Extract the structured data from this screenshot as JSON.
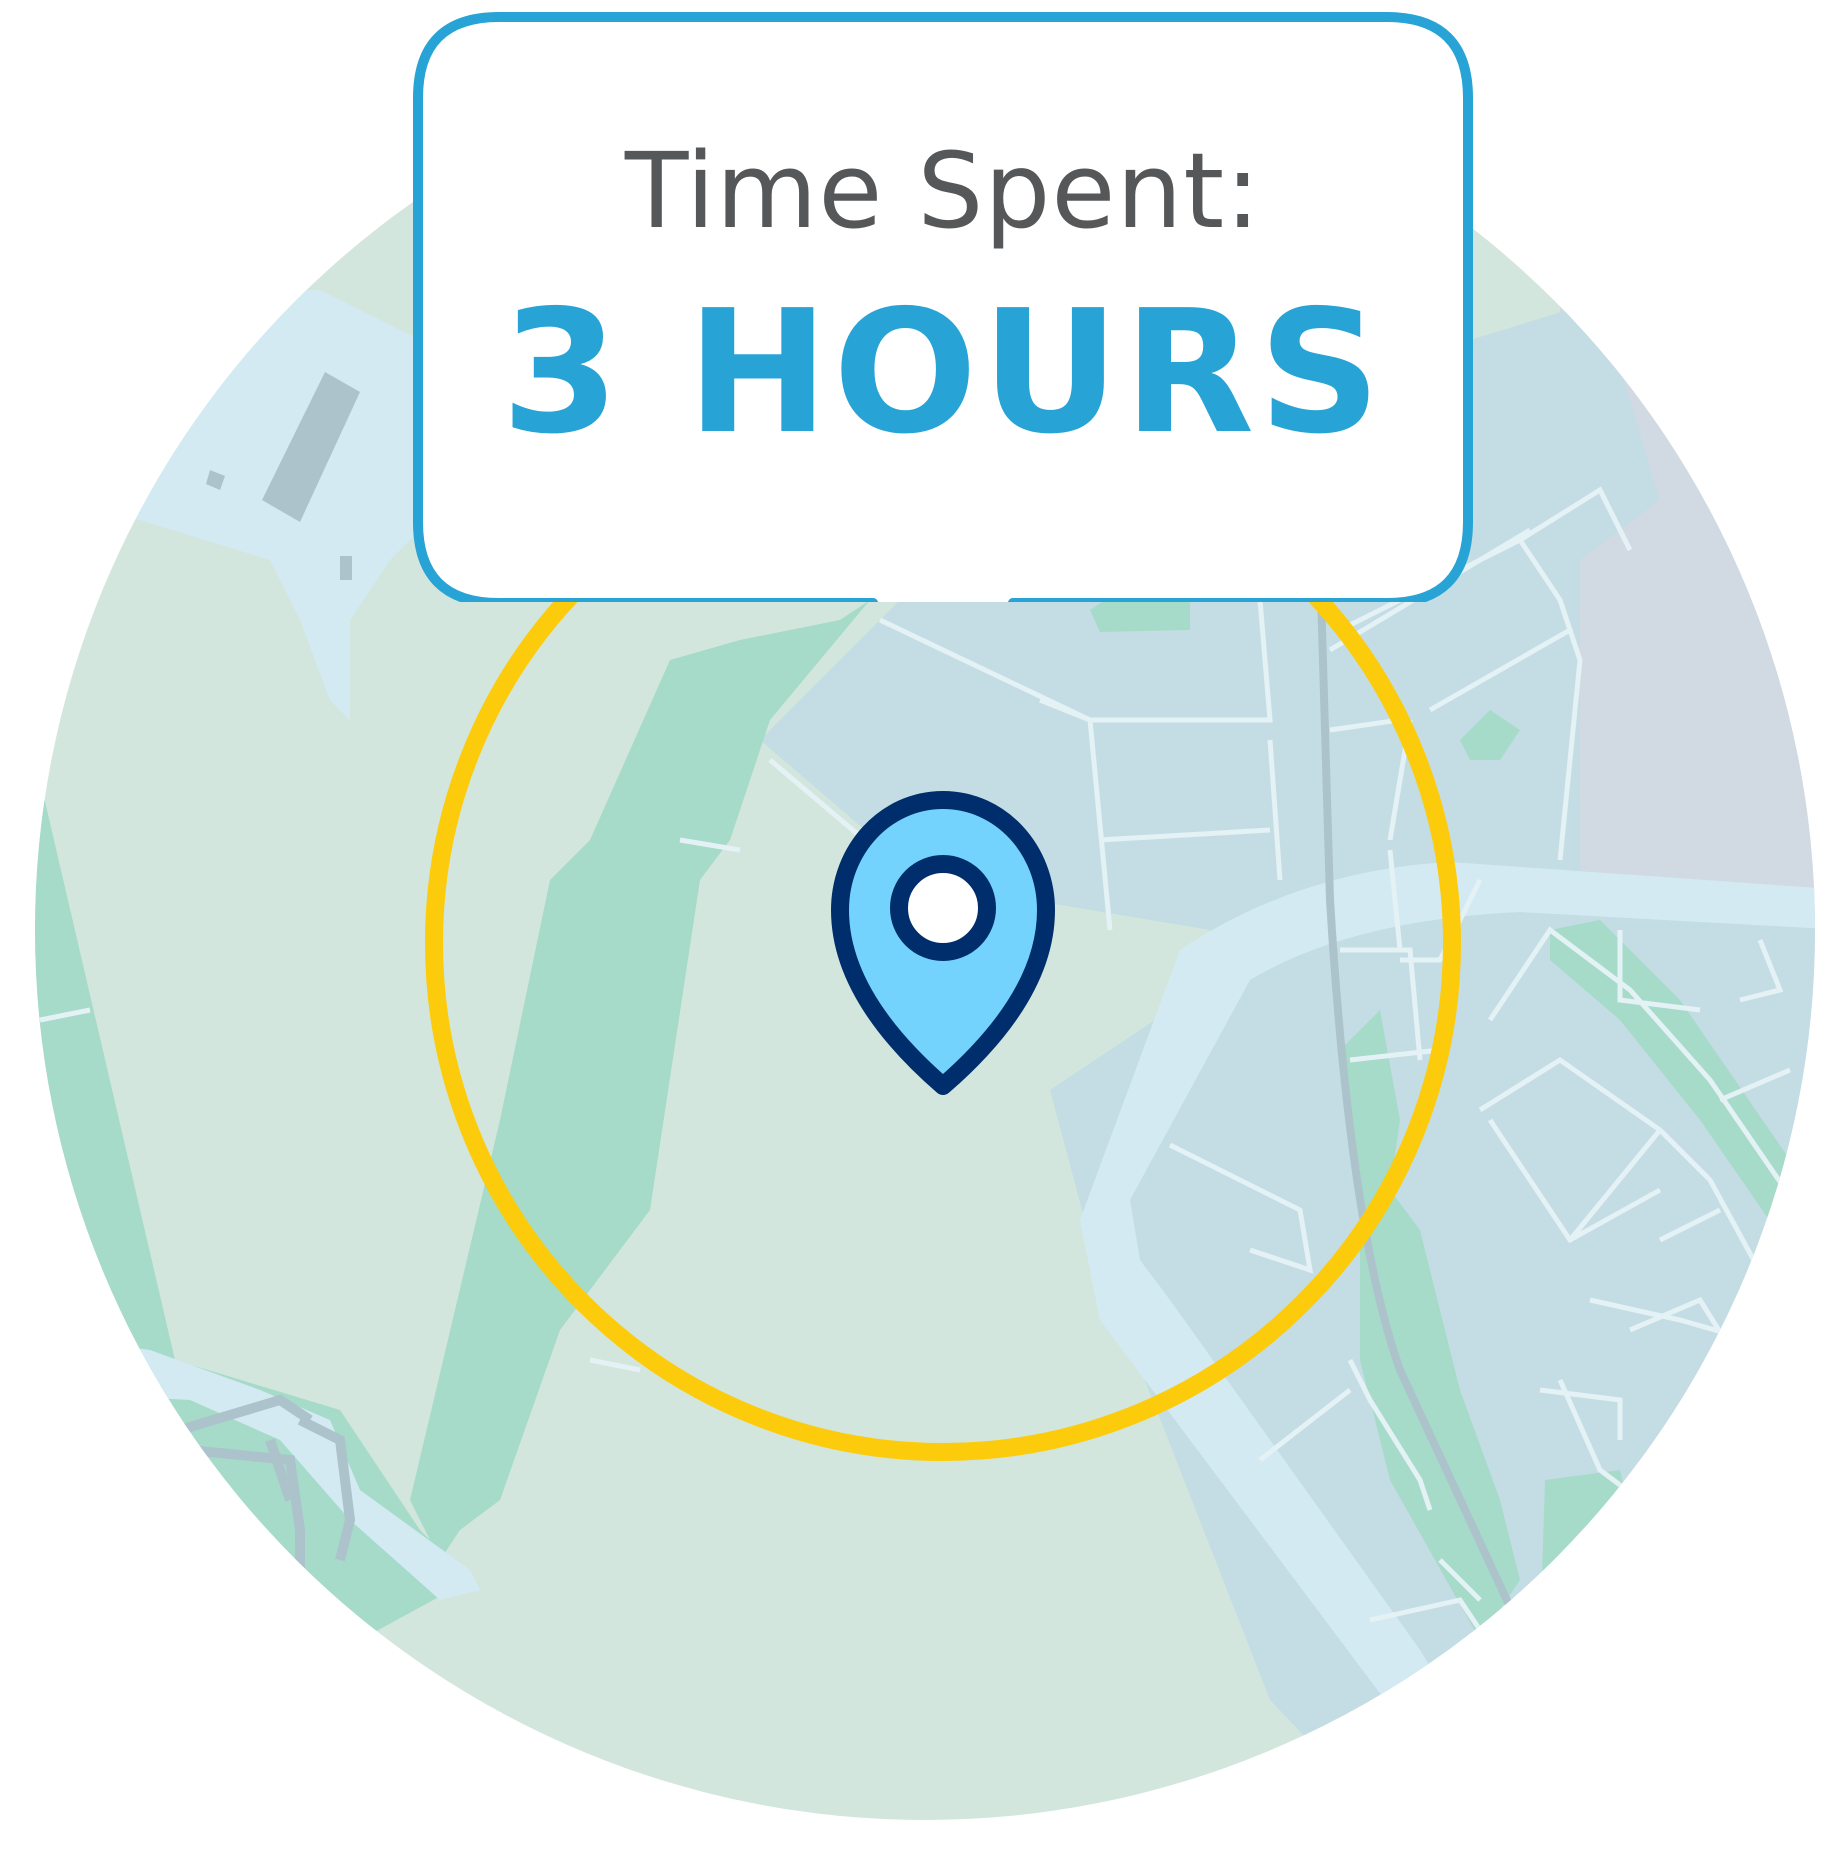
{
  "callout": {
    "label": "Time Spent:",
    "value": "3 HOURS"
  },
  "colors": {
    "land": "#d3e6dd",
    "urban": "#c4dde4",
    "park": "#a5dbc8",
    "water": "#d3eaf3",
    "road": "#e4f1f5",
    "region_gray": "#d1dae3",
    "geofence_ring": "#fccb0b",
    "callout_border": "#27a3d6",
    "callout_value": "#27a3d6",
    "callout_label": "#555759",
    "pin_outline": "#002e6d",
    "pin_fill": "#74d3fc"
  },
  "icons": {
    "pin": "location-pin-icon"
  }
}
